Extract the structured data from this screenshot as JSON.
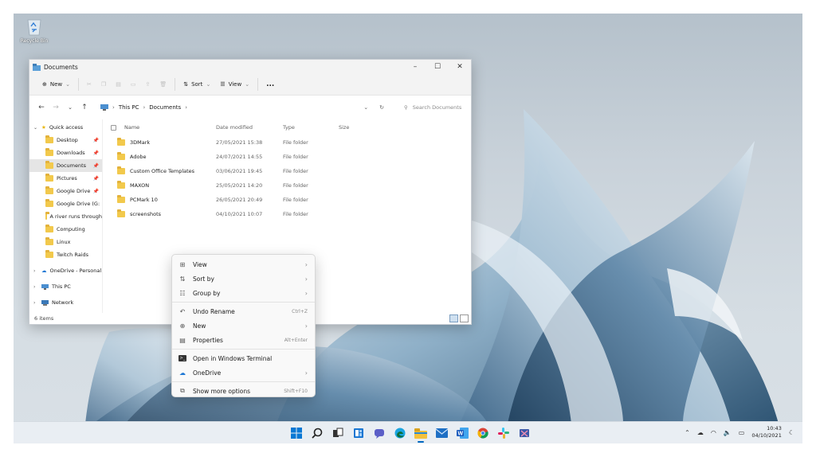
{
  "desktop": {
    "recycle_bin_label": "Recycle Bin"
  },
  "explorer": {
    "title": "Documents",
    "commands": {
      "new": "New",
      "sort": "Sort",
      "view": "View",
      "more": "..."
    },
    "breadcrumb": [
      "This PC",
      "Documents"
    ],
    "search_placeholder": "Search Documents",
    "sidebar": {
      "quick_access": "Quick access",
      "items": [
        {
          "label": "Desktop",
          "pinned": true
        },
        {
          "label": "Downloads",
          "pinned": true
        },
        {
          "label": "Documents",
          "pinned": true,
          "selected": true
        },
        {
          "label": "Pictures",
          "pinned": true
        },
        {
          "label": "Google Drive",
          "pinned": true
        },
        {
          "label": "Google Drive (G:",
          "pinned": false
        },
        {
          "label": "A river runs through",
          "pinned": false
        },
        {
          "label": "Computing",
          "pinned": false
        },
        {
          "label": "Linux",
          "pinned": false
        },
        {
          "label": "Twitch Raids",
          "pinned": false
        }
      ],
      "onedrive": "OneDrive - Personal",
      "this_pc": "This PC",
      "network": "Network"
    },
    "columns": {
      "name": "Name",
      "date": "Date modified",
      "type": "Type",
      "size": "Size"
    },
    "files": [
      {
        "name": "3DMark",
        "date": "27/05/2021 15:38",
        "type": "File folder"
      },
      {
        "name": "Adobe",
        "date": "24/07/2021 14:55",
        "type": "File folder"
      },
      {
        "name": "Custom Office Templates",
        "date": "03/06/2021 19:45",
        "type": "File folder"
      },
      {
        "name": "MAXON",
        "date": "25/05/2021 14:20",
        "type": "File folder"
      },
      {
        "name": "PCMark 10",
        "date": "26/05/2021 20:49",
        "type": "File folder"
      },
      {
        "name": "screenshots",
        "date": "04/10/2021 10:07",
        "type": "File folder"
      }
    ],
    "status": "6 items"
  },
  "context_menu": {
    "view": "View",
    "sort_by": "Sort by",
    "group_by": "Group by",
    "undo_rename": "Undo Rename",
    "undo_shortcut": "Ctrl+Z",
    "new": "New",
    "properties": "Properties",
    "properties_shortcut": "Alt+Enter",
    "terminal": "Open in Windows Terminal",
    "onedrive": "OneDrive",
    "more_options": "Show more options",
    "more_shortcut": "Shift+F10"
  },
  "taskbar": {
    "time": "10:43",
    "date": "04/10/2021"
  },
  "colors": {
    "accent": "#0067c0",
    "folder": "#f2c94c"
  }
}
